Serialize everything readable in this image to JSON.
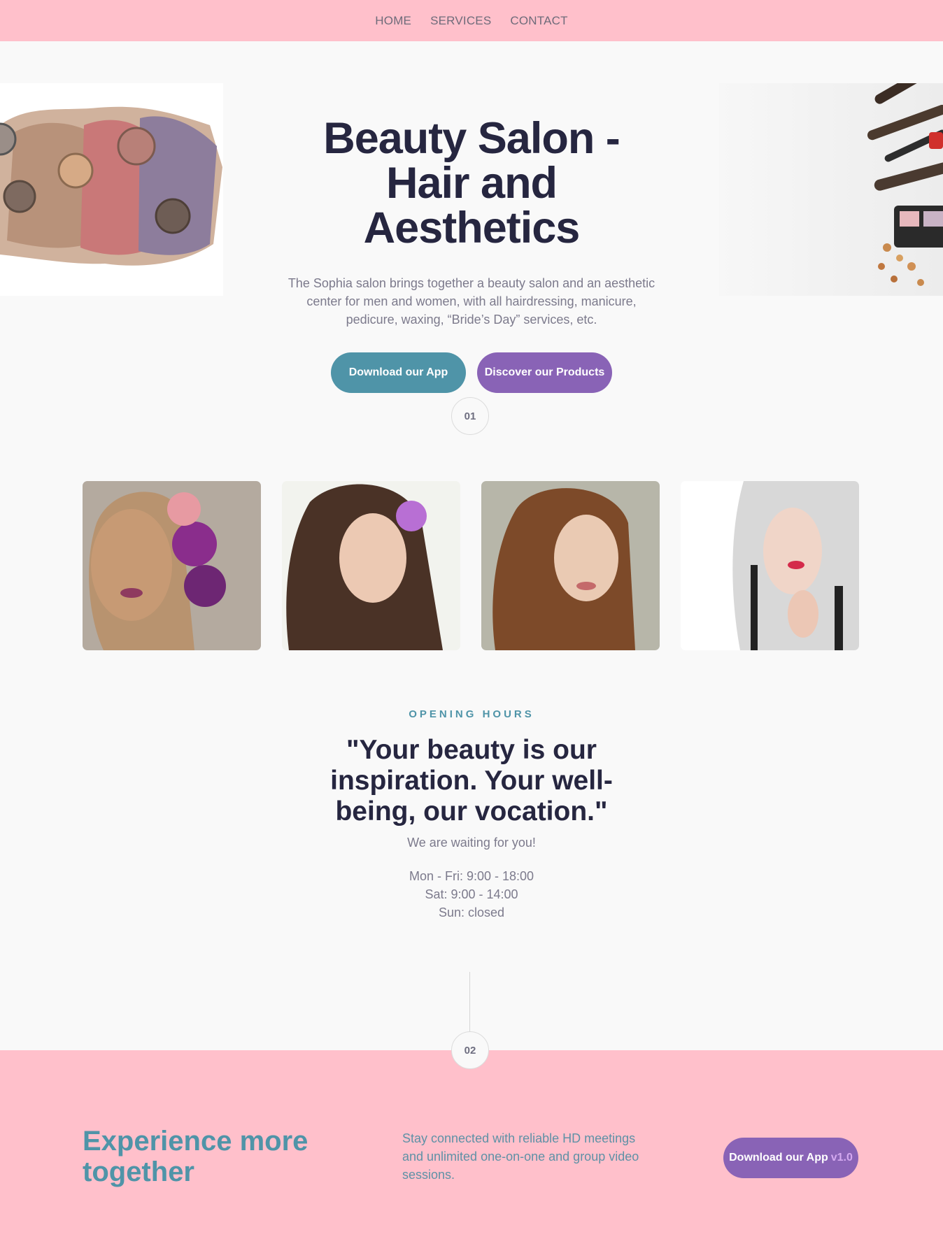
{
  "nav": {
    "items": [
      "HOME",
      "SERVICES",
      "CONTACT"
    ]
  },
  "hero": {
    "title": "Beauty Salon - Hair and Aesthetics",
    "description": "The Sophia salon brings together a beauty salon and an aesthetic center for men and women, with all hairdressing, manicure, pedicure, waxing, “Bride’s Day” services, etc.",
    "btn_app": "Download our App",
    "btn_products": "Discover our Products",
    "step": "01"
  },
  "gallery": {
    "images": [
      "woman-with-purple-roses",
      "woman-with-orchid",
      "woman-curly-hair",
      "woman-white-hair"
    ]
  },
  "hours": {
    "eyebrow": "OPENING HOURS",
    "quote": "\"Your beauty is our inspiration. Your well-being, our vocation.\"",
    "subtitle": "We are waiting for you!",
    "lines": [
      "Mon - Fri: 9:00 - 18:00",
      "Sat: 9:00 - 14:00",
      "Sun: closed"
    ],
    "step": "02"
  },
  "cta": {
    "title": "Experience more together",
    "description": "Stay connected with reliable HD meetings and unlimited one-on-one and group video sessions.",
    "btn_label": "Download our App",
    "btn_version": "v1.0"
  },
  "colors": {
    "pink": "#ffc0cb",
    "teal": "#4f94a8",
    "purple": "#8963b6",
    "dark": "#262640",
    "muted": "#7c7a8c"
  }
}
